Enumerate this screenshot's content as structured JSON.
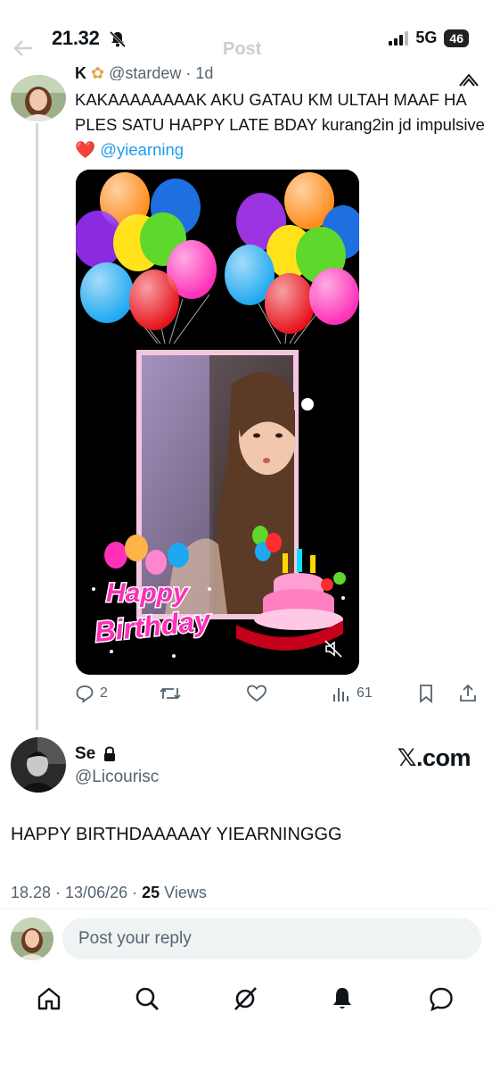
{
  "status_bar": {
    "time": "21.32",
    "network": "5G",
    "battery": "46"
  },
  "header": {
    "title": "Post"
  },
  "quoted_tweet": {
    "name": "K",
    "handle_meta": "@stardew · 1d",
    "text_main": "KAKAAAAAAAAK AKU GATAU KM ULTAH MAAF HA PLES SATU HAPPY LATE BDAY kurang2in jd impulsive",
    "heart_emoji": "❤️",
    "mention": "@yiearning",
    "media_caption": "Happy Birthday",
    "media_caption_top": "Happy",
    "media_caption_bottom": "Birthday",
    "replies": "2",
    "views": "61"
  },
  "main_tweet": {
    "name": "Se",
    "handle": "@Licourisc",
    "watermark": "𝕏.com",
    "text": "HAPPY BIRTHDAAAAAY YIEARNINGGG",
    "time": "18.28 · 13/06/26 · ",
    "views_count": "25",
    "views_label": " Views"
  },
  "reply_bar": {
    "placeholder": "Post your reply"
  },
  "colors": {
    "accent": "#1d9bf0",
    "text": "#0f1419",
    "muted": "#536471",
    "heart": "#e0245e"
  }
}
